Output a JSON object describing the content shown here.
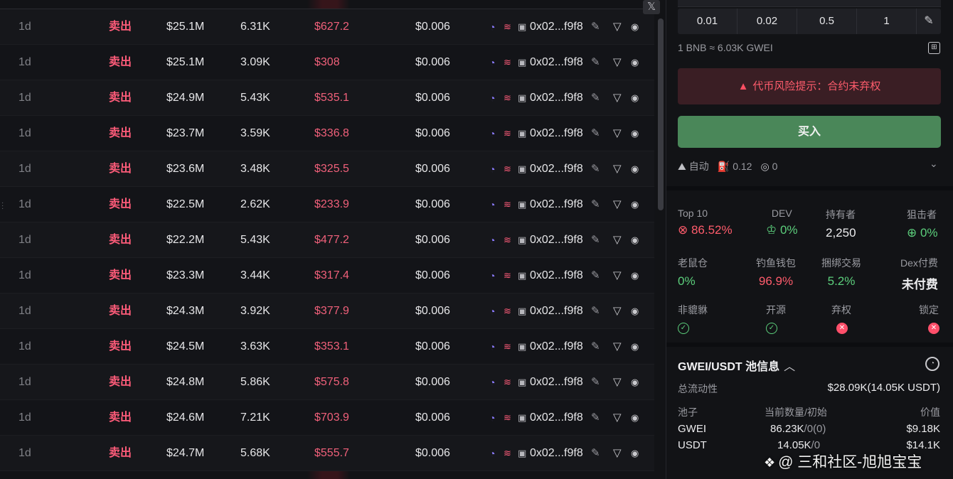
{
  "trades": {
    "close_icon": "x-close-icon",
    "rows": [
      {
        "age": "1d",
        "type": "卖出",
        "mcap": "$25.1M",
        "amount": "6.31K",
        "usd": "$627.2",
        "price": "$0.006",
        "address": "0x02...f9f8"
      },
      {
        "age": "1d",
        "type": "卖出",
        "mcap": "$25.1M",
        "amount": "3.09K",
        "usd": "$308",
        "price": "$0.006",
        "address": "0x02...f9f8"
      },
      {
        "age": "1d",
        "type": "卖出",
        "mcap": "$24.9M",
        "amount": "5.43K",
        "usd": "$535.1",
        "price": "$0.006",
        "address": "0x02...f9f8"
      },
      {
        "age": "1d",
        "type": "卖出",
        "mcap": "$23.7M",
        "amount": "3.59K",
        "usd": "$336.8",
        "price": "$0.006",
        "address": "0x02...f9f8"
      },
      {
        "age": "1d",
        "type": "卖出",
        "mcap": "$23.6M",
        "amount": "3.48K",
        "usd": "$325.5",
        "price": "$0.006",
        "address": "0x02...f9f8"
      },
      {
        "age": "1d",
        "type": "卖出",
        "mcap": "$22.5M",
        "amount": "2.62K",
        "usd": "$233.9",
        "price": "$0.006",
        "address": "0x02...f9f8"
      },
      {
        "age": "1d",
        "type": "卖出",
        "mcap": "$22.2M",
        "amount": "5.43K",
        "usd": "$477.2",
        "price": "$0.006",
        "address": "0x02...f9f8"
      },
      {
        "age": "1d",
        "type": "卖出",
        "mcap": "$23.3M",
        "amount": "3.44K",
        "usd": "$317.4",
        "price": "$0.006",
        "address": "0x02...f9f8"
      },
      {
        "age": "1d",
        "type": "卖出",
        "mcap": "$24.3M",
        "amount": "3.92K",
        "usd": "$377.9",
        "price": "$0.006",
        "address": "0x02...f9f8"
      },
      {
        "age": "1d",
        "type": "卖出",
        "mcap": "$24.5M",
        "amount": "3.63K",
        "usd": "$353.1",
        "price": "$0.006",
        "address": "0x02...f9f8"
      },
      {
        "age": "1d",
        "type": "卖出",
        "mcap": "$24.8M",
        "amount": "5.86K",
        "usd": "$575.8",
        "price": "$0.006",
        "address": "0x02...f9f8"
      },
      {
        "age": "1d",
        "type": "卖出",
        "mcap": "$24.6M",
        "amount": "7.21K",
        "usd": "$703.9",
        "price": "$0.006",
        "address": "0x02...f9f8"
      },
      {
        "age": "1d",
        "type": "卖出",
        "mcap": "$24.7M",
        "amount": "5.68K",
        "usd": "$555.7",
        "price": "$0.006",
        "address": "0x02...f9f8"
      }
    ]
  },
  "panel": {
    "quick_amounts": [
      "0.01",
      "0.02",
      "0.5",
      "1"
    ],
    "rate": "1 BNB ≈ 6.03K GWEI",
    "risk_text": "代币风险提示：合约未弃权",
    "buy_label": "买入",
    "settings": {
      "auto": "自动",
      "gas": "0.12",
      "tip": "0"
    },
    "stats": {
      "top10_label": "Top 10",
      "top10_value": "86.52%",
      "dev_label": "DEV",
      "dev_value": "0%",
      "holders_label": "持有者",
      "holders_value": "2,250",
      "snipers_label": "狙击者",
      "snipers_value": "0%",
      "rat_label": "老鼠仓",
      "rat_value": "0%",
      "phish_label": "钓鱼钱包",
      "phish_value": "96.9%",
      "bundle_label": "捆绑交易",
      "bundle_value": "5.2%",
      "dexpay_label": "Dex付费",
      "dexpay_value": "未付费",
      "honeypot_label": "非貔貅",
      "opensource_label": "开源",
      "renounce_label": "弃权",
      "lock_label": "锁定"
    },
    "pool": {
      "title": "GWEI/USDT 池信息",
      "liquidity_label": "总流动性",
      "liquidity_value": "$28.09K(14.05K USDT)",
      "col_pool": "池子",
      "col_qty": "当前数量/初始",
      "col_value": "价值",
      "rows": [
        {
          "name": "GWEI",
          "qty": "86.23K",
          "init": "/0(0)",
          "value": "$9.18K"
        },
        {
          "name": "USDT",
          "qty": "14.05K",
          "init": "/0",
          "value": "$14.1K"
        }
      ]
    }
  },
  "watermark": "@ 三和社区-旭旭宝宝",
  "colors": {
    "sell": "#ff5c7a",
    "buy_button": "#4a8759",
    "risk_bg": "#3a1e24",
    "green": "#5ccf7c"
  }
}
